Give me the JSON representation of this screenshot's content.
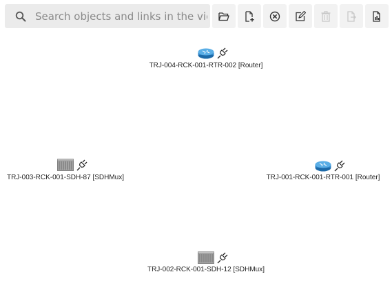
{
  "search": {
    "placeholder": "Search objects and links in the view"
  },
  "toolbar": {
    "buttons": [
      {
        "name": "open-folder",
        "icon": "folder-open-icon",
        "enabled": true
      },
      {
        "name": "new-file",
        "icon": "file-plus-icon",
        "enabled": true
      },
      {
        "name": "remove",
        "icon": "close-circle-icon",
        "enabled": true
      },
      {
        "name": "edit",
        "icon": "edit-icon",
        "enabled": true
      },
      {
        "name": "delete",
        "icon": "trash-icon",
        "enabled": false
      },
      {
        "name": "export",
        "icon": "file-export-icon",
        "enabled": false
      },
      {
        "name": "report",
        "icon": "file-chart-icon",
        "enabled": true
      }
    ]
  },
  "colors": {
    "router_blue": "#2f86c9",
    "sdh_gray": "#9a9a9a",
    "search_bg": "#ebebeb",
    "icon_dark": "#333333",
    "icon_disabled": "#c8c8c8"
  },
  "nodes": [
    {
      "id": "rtr-002",
      "label": "TRJ-004-RCK-001-RTR-002 [Router]",
      "type": "router",
      "status_icon": "plug-icon"
    },
    {
      "id": "sdh-87",
      "label": "TRJ-003-RCK-001-SDH-87 [SDHMux]",
      "type": "sdhmux",
      "status_icon": "plug-icon"
    },
    {
      "id": "rtr-001",
      "label": "TRJ-001-RCK-001-RTR-001 [Router]",
      "type": "router",
      "status_icon": "plug-icon"
    },
    {
      "id": "sdh-12",
      "label": "TRJ-002-RCK-001-SDH-12 [SDHMux]",
      "type": "sdhmux",
      "status_icon": "plug-icon"
    }
  ]
}
